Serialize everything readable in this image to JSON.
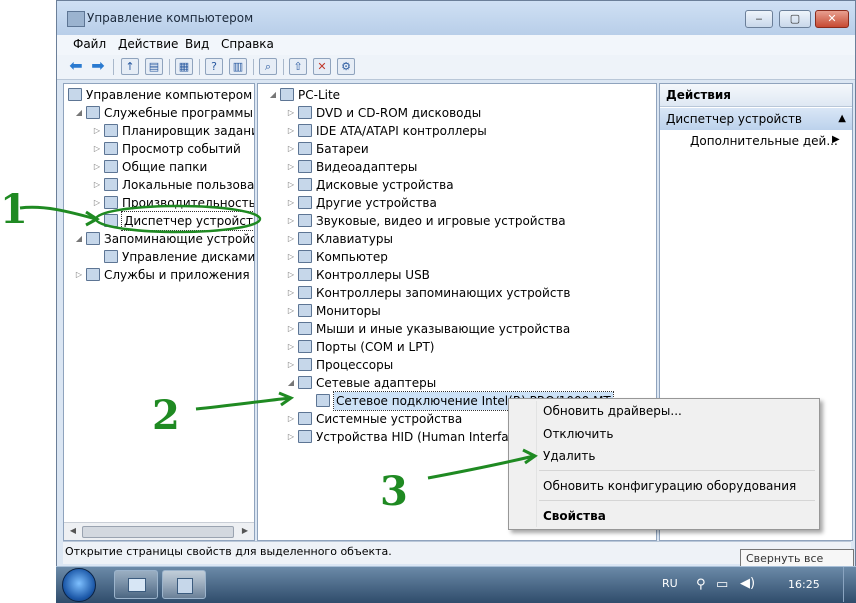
{
  "window": {
    "title": "Управление компьютером",
    "minimize": "‒",
    "maximize": "▢",
    "close": "✕"
  },
  "menu": [
    "Файл",
    "Действие",
    "Вид",
    "Справка"
  ],
  "toolbar": {
    "icons": [
      "back-arrow-icon",
      "forward-arrow-icon",
      "up-folder-icon",
      "show-tree-icon",
      "properties-icon",
      "help-icon",
      "show-action-pane-icon",
      "scan-hardware-icon",
      "update-driver-icon",
      "disable-device-icon",
      "uninstall-device-icon"
    ]
  },
  "left_tree": [
    {
      "label": "Управление компьютером (л",
      "level": 0,
      "exp": ""
    },
    {
      "label": "Служебные программы",
      "level": 1,
      "exp": "◢"
    },
    {
      "label": "Планировщик заданий",
      "level": 2,
      "exp": "▷"
    },
    {
      "label": "Просмотр событий",
      "level": 2,
      "exp": "▷"
    },
    {
      "label": "Общие папки",
      "level": 2,
      "exp": "▷"
    },
    {
      "label": "Локальные пользовате",
      "level": 2,
      "exp": "▷"
    },
    {
      "label": "Производительность",
      "level": 2,
      "exp": "▷"
    },
    {
      "label": "Диспетчер устройств",
      "level": 2,
      "exp": "",
      "selected": true
    },
    {
      "label": "Запоминающие устройст",
      "level": 1,
      "exp": "◢"
    },
    {
      "label": "Управление дисками",
      "level": 2,
      "exp": ""
    },
    {
      "label": "Службы и приложения",
      "level": 1,
      "exp": "▷"
    }
  ],
  "device_tree": [
    {
      "label": "PC-Lite",
      "level": 0,
      "exp": "◢"
    },
    {
      "label": "DVD и CD-ROM дисководы",
      "level": 1,
      "exp": "▷"
    },
    {
      "label": "IDE ATA/ATAPI контроллеры",
      "level": 1,
      "exp": "▷"
    },
    {
      "label": "Батареи",
      "level": 1,
      "exp": "▷"
    },
    {
      "label": "Видеоадаптеры",
      "level": 1,
      "exp": "▷"
    },
    {
      "label": "Дисковые устройства",
      "level": 1,
      "exp": "▷"
    },
    {
      "label": "Другие устройства",
      "level": 1,
      "exp": "▷"
    },
    {
      "label": "Звуковые, видео и игровые устройства",
      "level": 1,
      "exp": "▷"
    },
    {
      "label": "Клавиатуры",
      "level": 1,
      "exp": "▷"
    },
    {
      "label": "Компьютер",
      "level": 1,
      "exp": "▷"
    },
    {
      "label": "Контроллеры USB",
      "level": 1,
      "exp": "▷"
    },
    {
      "label": "Контроллеры запоминающих устройств",
      "level": 1,
      "exp": "▷"
    },
    {
      "label": "Мониторы",
      "level": 1,
      "exp": "▷"
    },
    {
      "label": "Мыши и иные указывающие устройства",
      "level": 1,
      "exp": "▷"
    },
    {
      "label": "Порты (COM и LPT)",
      "level": 1,
      "exp": "▷"
    },
    {
      "label": "Процессоры",
      "level": 1,
      "exp": "▷"
    },
    {
      "label": "Сетевые адаптеры",
      "level": 1,
      "exp": "◢"
    },
    {
      "label": "Сетевое подключение Intel(R) PRO/1000 MT",
      "level": 2,
      "exp": "",
      "selected": true
    },
    {
      "label": "Системные устройства",
      "level": 1,
      "exp": "▷"
    },
    {
      "label": "Устройства HID (Human Interface D",
      "level": 1,
      "exp": "▷"
    }
  ],
  "actions": {
    "header": "Действия",
    "section": "Диспетчер устройств",
    "section_arrow": "▲",
    "more": "Дополнительные дей...",
    "more_arrow": "▶"
  },
  "context_menu": {
    "items": [
      "Обновить драйверы...",
      "Отключить",
      "Удалить",
      "Обновить конфигурацию оборудования",
      "Свойства"
    ]
  },
  "status": "Открытие страницы свойств для выделенного объекта.",
  "taskbar": {
    "lang": "RU",
    "time": "16:25",
    "tooltip": "Свернуть все окна"
  },
  "annotations": [
    "1",
    "2",
    "3"
  ],
  "colors": {
    "annotation": "#1f8a22",
    "selection": "#cde2f7",
    "window_bg": "#dbe6f3"
  }
}
